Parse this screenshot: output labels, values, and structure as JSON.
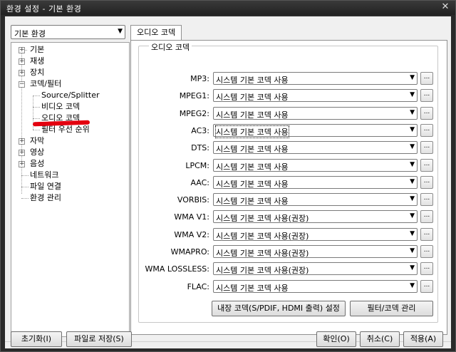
{
  "window": {
    "title": "환경 설정 - 기본 환경",
    "close_glyph": "✕"
  },
  "category": {
    "selected": "기본 환경"
  },
  "tree": {
    "items": [
      {
        "label": "기본",
        "expander": "+"
      },
      {
        "label": "재생",
        "expander": "+"
      },
      {
        "label": "장치",
        "expander": "+"
      },
      {
        "label": "코덱/필터",
        "expander": "−"
      },
      {
        "label": "Source/Splitter"
      },
      {
        "label": "비디오 코덱"
      },
      {
        "label": "오디오 코덱"
      },
      {
        "label": "필터 우선 순위"
      },
      {
        "label": "자막",
        "expander": "+"
      },
      {
        "label": "영상",
        "expander": "+"
      },
      {
        "label": "음성",
        "expander": "+"
      },
      {
        "label": "네트워크"
      },
      {
        "label": "파일 연결"
      },
      {
        "label": "환경 관리"
      }
    ]
  },
  "tab": {
    "label": "오디오 코덱"
  },
  "group": {
    "title": "오디오 코덱"
  },
  "codecs": [
    {
      "label": "MP3:",
      "value": "시스템 기본 코덱 사용"
    },
    {
      "label": "MPEG1:",
      "value": "시스템 기본 코덱 사용"
    },
    {
      "label": "MPEG2:",
      "value": "시스템 기본 코덱 사용"
    },
    {
      "label": "AC3:",
      "value": "시스템 기본 코덱 사용"
    },
    {
      "label": "DTS:",
      "value": "시스템 기본 코덱 사용"
    },
    {
      "label": "LPCM:",
      "value": "시스템 기본 코덱 사용"
    },
    {
      "label": "AAC:",
      "value": "시스템 기본 코덱 사용"
    },
    {
      "label": "VORBIS:",
      "value": "시스템 기본 코덱 사용"
    },
    {
      "label": "WMA V1:",
      "value": "시스템 기본 코덱 사용(권장)"
    },
    {
      "label": "WMA V2:",
      "value": "시스템 기본 코덱 사용(권장)"
    },
    {
      "label": "WMAPRO:",
      "value": "시스템 기본 코덱 사용(권장)"
    },
    {
      "label": "WMA LOSSLESS:",
      "value": "시스템 기본 코덱 사용(권장)"
    },
    {
      "label": "FLAC:",
      "value": "시스템 기본 코덱 사용"
    }
  ],
  "dots_label": "...",
  "actions": {
    "internal_codec": "내장 코덱(S/PDIF, HDMI 출력) 설정",
    "filter_manage": "필터/코덱 관리"
  },
  "footer": {
    "reset": "초기화(I)",
    "save_file": "파일로 저장(S)",
    "ok": "확인(O)",
    "cancel": "취소(C)",
    "apply": "적용(A)"
  }
}
